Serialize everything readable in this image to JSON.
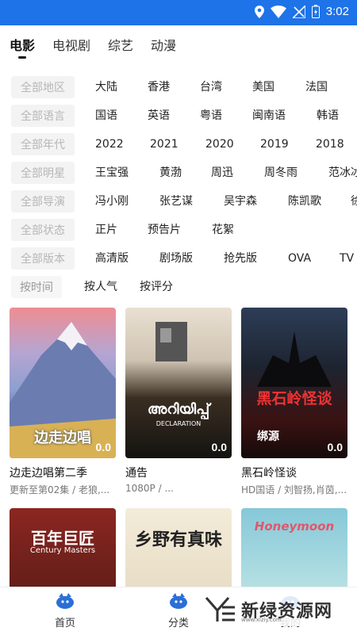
{
  "status": {
    "time": "3:02"
  },
  "tabs": [
    "电影",
    "电视剧",
    "综艺",
    "动漫"
  ],
  "filters": [
    {
      "label": "全部地区",
      "options": [
        "大陆",
        "香港",
        "台湾",
        "美国",
        "法国"
      ]
    },
    {
      "label": "全部语言",
      "options": [
        "国语",
        "英语",
        "粤语",
        "闽南语",
        "韩语"
      ]
    },
    {
      "label": "全部年代",
      "options": [
        "2022",
        "2021",
        "2020",
        "2019",
        "2018"
      ]
    },
    {
      "label": "全部明星",
      "options": [
        "王宝强",
        "黄渤",
        "周迅",
        "周冬雨",
        "范冰冰"
      ]
    },
    {
      "label": "全部导演",
      "options": [
        "冯小刚",
        "张艺谋",
        "吴宇森",
        "陈凯歌",
        "徐"
      ]
    },
    {
      "label": "全部状态",
      "options": [
        "正片",
        "预告片",
        "花絮"
      ]
    },
    {
      "label": "全部版本",
      "options": [
        "高清版",
        "剧场版",
        "抢先版",
        "OVA",
        "TV"
      ]
    }
  ],
  "sort": {
    "label": "按时间",
    "options": [
      "按人气",
      "按评分"
    ]
  },
  "movies": [
    {
      "title": "边走边唱第二季",
      "sub": "更新至第02集 / 老狼,...",
      "score": "0.0",
      "poster_text": "边走边唱"
    },
    {
      "title": "通告",
      "sub": "1080P / ...",
      "score": "0.0",
      "poster_text": "അറിയിപ്പ്",
      "poster_sub": "DECLARATION"
    },
    {
      "title": "黑石岭怪谈",
      "sub": "HD国语 / 刘智扬,肖茵,...",
      "score": "0.0",
      "poster_text": "黑石岭怪谈",
      "poster_sub": "绑源"
    },
    {
      "title": "",
      "sub": "",
      "poster_text": "百年巨匠",
      "poster_sub": "Century Masters"
    },
    {
      "title": "",
      "sub": "",
      "poster_text": "乡野有真味"
    },
    {
      "title": "",
      "sub": "",
      "poster_text": "Honeymoon"
    }
  ],
  "nav": [
    "首页",
    "分类",
    "我的"
  ],
  "watermark": {
    "text": "新绿资源网",
    "url": "www.xlziy.com"
  }
}
